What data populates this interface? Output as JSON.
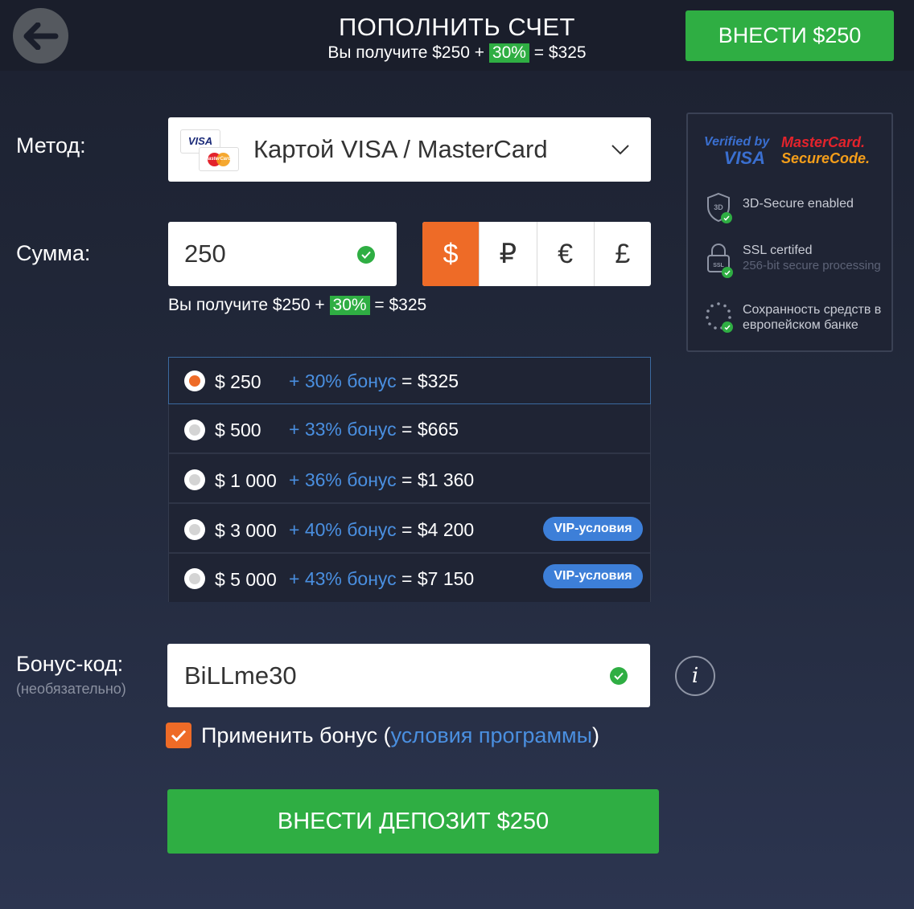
{
  "header": {
    "title": "ПОПОЛНИТЬ СЧЕТ",
    "sub_prefix": "Вы получите",
    "sub_amount": "$250 +",
    "sub_percent": "30%",
    "sub_total": "= $325",
    "cta_label": "ВНЕСТИ $250"
  },
  "method": {
    "label": "Метод:",
    "value": "Картой VISA / MasterCard",
    "card_visa": "VISA",
    "card_mc": "MasterCard"
  },
  "amount": {
    "label": "Сумма:",
    "value": "250",
    "currencies": [
      "$",
      "₽",
      "€",
      "£"
    ],
    "selected_currency": "$",
    "receive_prefix": "Вы получите",
    "receive_amount": "$250 +",
    "receive_percent": "30%",
    "receive_total": "= $325"
  },
  "options": [
    {
      "amount": "$ 250",
      "bonus": "+ 30% бонус",
      "total": "= $325",
      "vip": "",
      "selected": true
    },
    {
      "amount": "$ 500",
      "bonus": "+ 33% бонус",
      "total": "= $665",
      "vip": "",
      "selected": false
    },
    {
      "amount": "$ 1 000",
      "bonus": "+ 36% бонус",
      "total": "= $1 360",
      "vip": "",
      "selected": false
    },
    {
      "amount": "$ 3 000",
      "bonus": "+ 40% бонус",
      "total": "= $4 200",
      "vip": "VIP-условия",
      "selected": false
    },
    {
      "amount": "$ 5 000",
      "bonus": "+ 43% бонус",
      "total": "= $7 150",
      "vip": "VIP-условия",
      "selected": false
    }
  ],
  "bonus_code": {
    "label": "Бонус-код:",
    "optional": "(необязательно)",
    "value": "BiLLme30",
    "info_icon": "i"
  },
  "apply": {
    "checked": true,
    "text_before": "Применить бонус (",
    "link": "условия программы",
    "text_after": ")"
  },
  "submit_label": "ВНЕСТИ ДЕПОЗИТ $250",
  "security": {
    "verified_line1": "Verified by",
    "verified_line2": "VISA",
    "mc_line1": "MasterCard.",
    "mc_line2": "SecureCode.",
    "items": [
      {
        "title": "3D-Secure enabled",
        "subtitle": ""
      },
      {
        "title": "SSL certifed",
        "subtitle": "256-bit secure processing"
      },
      {
        "title": "Сохранность средств в европейском банке",
        "subtitle": ""
      }
    ],
    "shield_text": "3D",
    "lock_text": "SSL"
  },
  "colors": {
    "accent_green": "#2fae43",
    "accent_orange": "#ee6b27",
    "link_blue": "#4a8fe0",
    "vip_blue": "#3d7fd8"
  }
}
